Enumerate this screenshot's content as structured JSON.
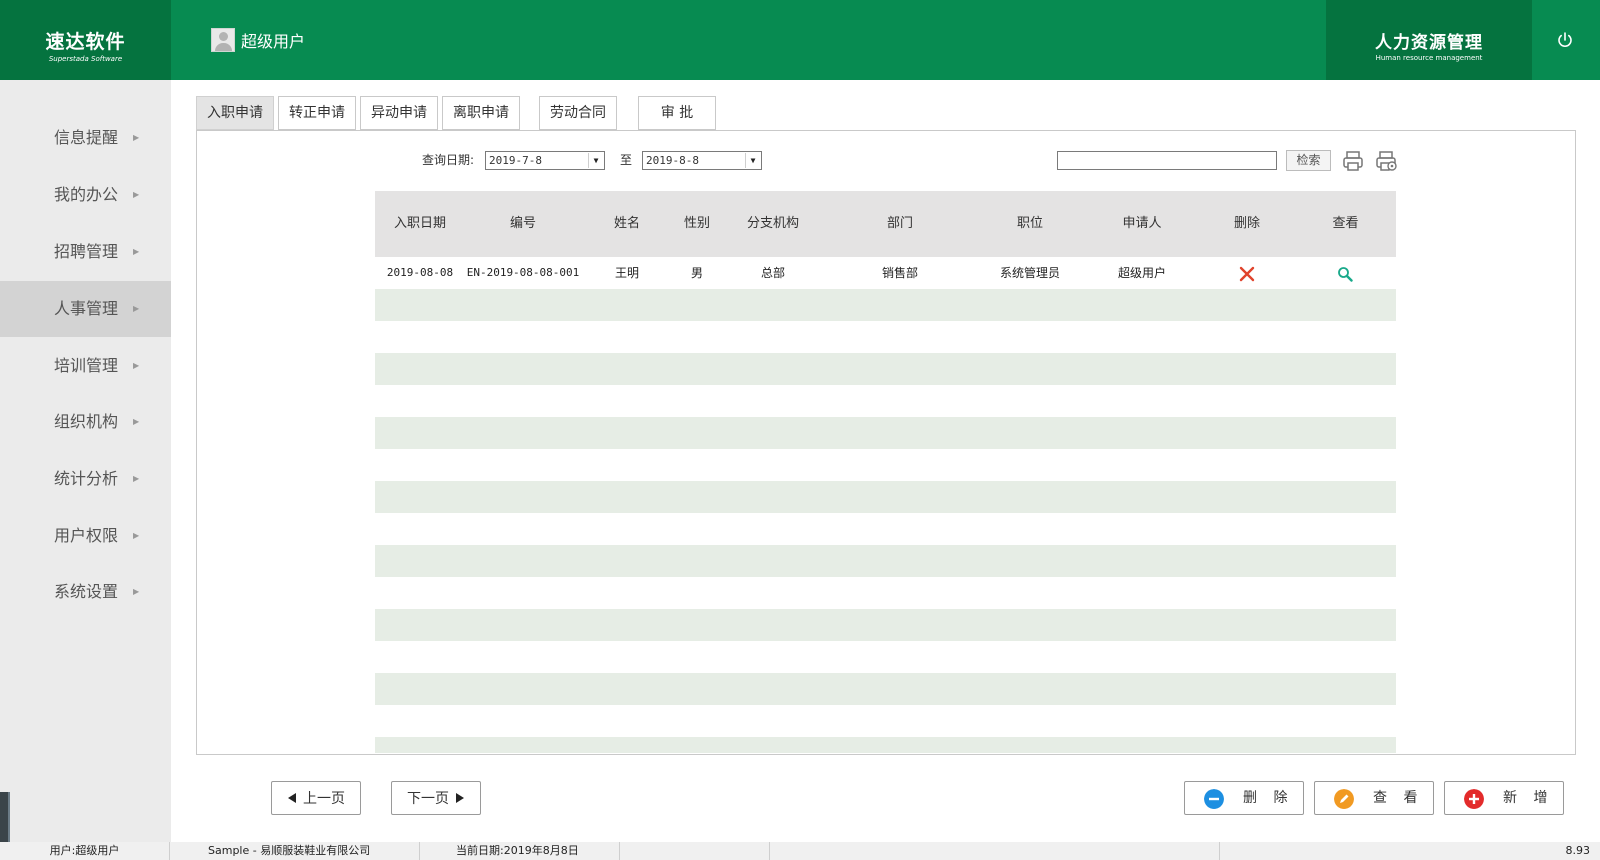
{
  "header": {
    "logo_cn": "速达软件",
    "logo_en": "Superstada Software",
    "user_name": "超级用户",
    "brand_cn": "人力资源管理",
    "brand_en": "Human resource management"
  },
  "sidebar": {
    "items": [
      {
        "label": "信息提醒",
        "active": false
      },
      {
        "label": "我的办公",
        "active": false
      },
      {
        "label": "招聘管理",
        "active": false
      },
      {
        "label": "人事管理",
        "active": true
      },
      {
        "label": "培训管理",
        "active": false
      },
      {
        "label": "组织机构",
        "active": false
      },
      {
        "label": "统计分析",
        "active": false
      },
      {
        "label": "用户权限",
        "active": false
      },
      {
        "label": "系统设置",
        "active": false
      }
    ]
  },
  "tabs": [
    "入职申请",
    "转正申请",
    "异动申请",
    "离职申请",
    "劳动合同",
    "审 批"
  ],
  "active_tab": "入职申请",
  "query": {
    "date_label": "查询日期:",
    "date_from": "2019-7-8",
    "to_label": "至",
    "date_to": "2019-8-8",
    "search_value": "",
    "search_button": "检索"
  },
  "table": {
    "columns": [
      "入职日期",
      "编号",
      "姓名",
      "性别",
      "分支机构",
      "部门",
      "职位",
      "申请人",
      "删除",
      "查看"
    ],
    "rows": [
      {
        "date": "2019-08-08",
        "code": "EN-2019-08-08-001",
        "name": "王明",
        "gender": "男",
        "branch": "总部",
        "dept": "销售部",
        "position": "系统管理员",
        "applicant": "超级用户"
      }
    ]
  },
  "footer": {
    "prev_label": "上一页",
    "next_label": "下一页",
    "delete_label": "删 除",
    "view_label": "查 看",
    "add_label": "新 增"
  },
  "status": {
    "user": "用户:超级用户",
    "company": "Sample - 易顺服装鞋业有限公司",
    "date": "当前日期:2019年8月8日",
    "version": "8.93"
  },
  "colors": {
    "header_green": "#078b51",
    "header_dark_green": "#05733f",
    "row_stripe": "#e6ede5",
    "delete_red": "#e0432c",
    "view_green": "#19a98a",
    "edit_orange": "#f19a22",
    "remove_blue": "#1d8fe1"
  },
  "icons": {
    "power": "power-icon",
    "print": "printer-icon",
    "print_setup": "print-settings-icon",
    "row_delete": "close-icon",
    "row_view": "search-icon"
  }
}
